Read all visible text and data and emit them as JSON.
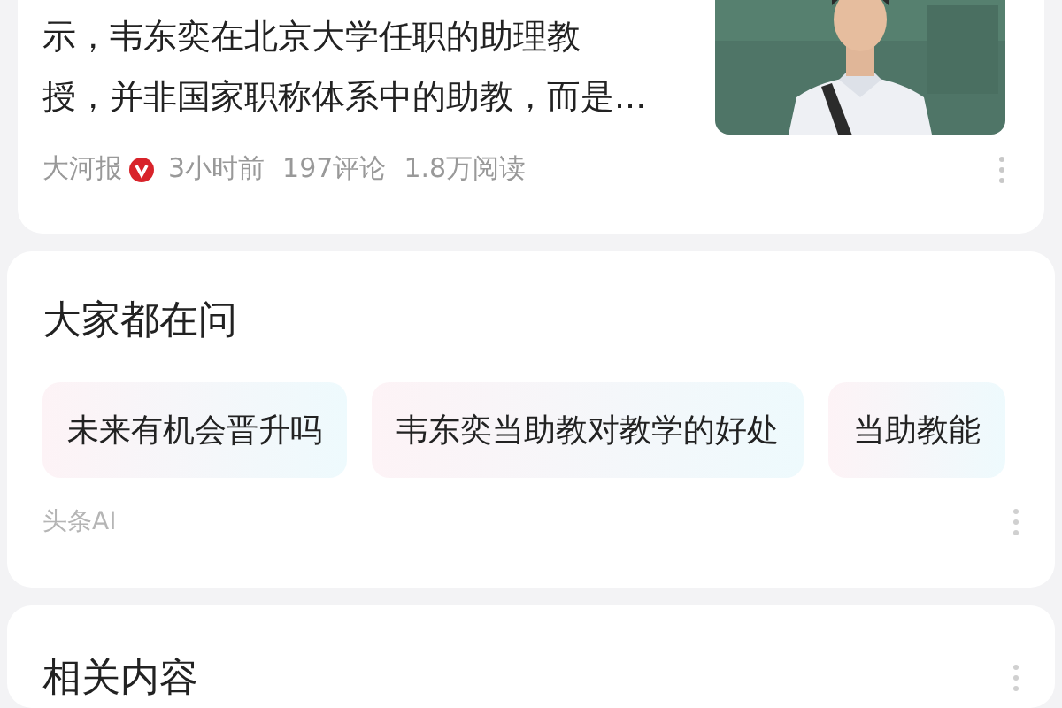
{
  "article": {
    "summary_lines": [
      "示，韦东奕在北京大学任职的助理教",
      "授，并非国家职称体系中的助教，而是..."
    ],
    "source": "大河报",
    "verified": true,
    "time": "3小时前",
    "comments": "197评论",
    "reads": "1.8万阅读"
  },
  "questions": {
    "title": "大家都在问",
    "chips": [
      "未来有机会晋升吗",
      "韦东奕当助教对教学的好处",
      "当助教能"
    ],
    "footer": "头条AI"
  },
  "related": {
    "title": "相关内容"
  }
}
